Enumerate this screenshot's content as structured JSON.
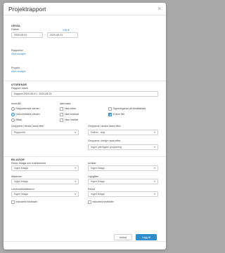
{
  "dialog": {
    "title": "Projektrapport",
    "close_glyph": "×"
  },
  "selection": {
    "heading": "URVAL",
    "date_label": "Datum",
    "date_shortcut": "Välj ▾",
    "date_from": "2020-05-01",
    "date_separator": "–",
    "date_to": "2020-05-31",
    "reports_label": "Rapportör",
    "reports_link": "Alla utvalgte",
    "projects_label": "Projekt",
    "projects_link": "Alla utvalgte"
  },
  "output": {
    "heading": "UTSEENDE",
    "report_title_label": "Rapport rubrik",
    "report_title_value": "Rapport 2020-05-01 - 2020-05-31",
    "content_label": "Innehåll",
    "content_options": [
      "Rapporterade värden",
      "Halvområdets värden",
      "Båda"
    ],
    "content_selected": 1,
    "alternatives_label": "Alternativ",
    "alternatives_col1": [
      "Visa initial",
      "Visa kostnad",
      "Visa resultat"
    ],
    "alternatives_col2": [
      "Signeringsrad på försättsblad",
      "Extern fält"
    ],
    "alternatives_col2_checked": [
      false,
      true
    ],
    "group_first_label": "Gruppera i första hand efter",
    "group_first_value": "Rapportör",
    "group_second_label": "Gruppera i andra hand efter",
    "group_second_value": "Datum - dag",
    "group_third_label": "Gruppera i tredje hand efter",
    "group_third_value": "Ingen ytterligare gruppering"
  },
  "attachments": {
    "heading": "BILAGOR",
    "travel_label": "Resa, bilaga och traktamente",
    "travel_value": "Ingen bilaga",
    "articles_label": "Artiklar",
    "articles_value": "Ingen bilaga",
    "machines_label": "Maskiner",
    "machines_value": "Ingen bilaga",
    "tasks_label": "Uppgifter",
    "tasks_value": "Ingen bilaga",
    "supplier_label": "Leverantörsfakturor",
    "supplier_value": "Ingen bilaga",
    "trips_label": "Resor",
    "trips_value": "Ingen bilaga",
    "include_photos_label": "Inkludera fotobilder",
    "include_notes_label": "Inkludera textbilder"
  },
  "footer": {
    "cancel_label": "Avbryt",
    "create_label": "Lägg till"
  },
  "colors": {
    "accent": "#2e8ccc",
    "overlay": "#a9a9a9"
  }
}
